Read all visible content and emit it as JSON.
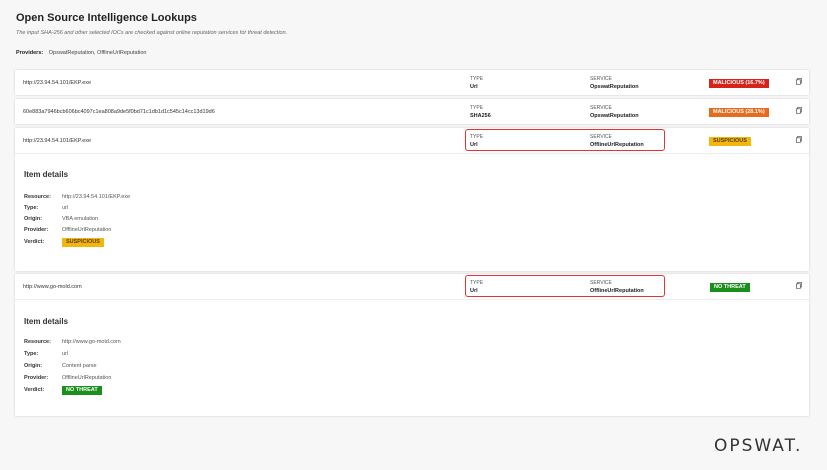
{
  "header": {
    "title": "Open Source Intelligence Lookups",
    "subtitle": "The input SHA-256 and other selected IOCs are checked against online reputation services for threat detection.",
    "providers_label": "Providers:",
    "providers_value": "OpswatReputation, OfflineUrlReputation"
  },
  "columns": {
    "type_label": "TYPE",
    "service_label": "SERVICE"
  },
  "rows": [
    {
      "resource": "http://23.94.54.101/EKP.exe",
      "type": "Url",
      "service": "OpswatReputation",
      "verdict": "MALICIOUS (16.7%)"
    },
    {
      "resource": "60e883a7946bcb606bc4097c1ea808a9de5f0bd71c1db1d1c545c14cc13d19d6",
      "type": "SHA256",
      "service": "OpswatReputation",
      "verdict": "MALICIOUS (28.1%)"
    },
    {
      "resource": "http://23.94.54.101/EKP.exe",
      "type": "Url",
      "service": "OfflineUrlReputation",
      "verdict": "SUSPICIOUS"
    },
    {
      "resource": "http://www.go-mold.com",
      "type": "Url",
      "service": "OfflineUrlReputation",
      "verdict": "NO THREAT"
    }
  ],
  "details_labels": {
    "title": "Item details",
    "resource": "Resource:",
    "type": "Type:",
    "origin": "Origin:",
    "provider": "Provider:",
    "verdict": "Verdict:"
  },
  "details": [
    {
      "resource": "http://23.94.54.101/EKP.exe",
      "type": "url",
      "origin": "VBA emulation",
      "provider": "OfflineUrlReputation",
      "verdict": "SUSPICIOUS"
    },
    {
      "resource": "http://www.go-mold.com",
      "type": "url",
      "origin": "Content parse",
      "provider": "OfflineUrlReputation",
      "verdict": "NO THREAT"
    }
  ],
  "brand": {
    "logo": "OPSWAT."
  },
  "colors": {
    "malicious": "#d6241d",
    "malicious_orange": "#e86a1c",
    "suspicious": "#f2b60f",
    "no_threat": "#1b8f1b",
    "highlight": "#e23434"
  },
  "icons": {
    "copy": "copy-icon"
  }
}
